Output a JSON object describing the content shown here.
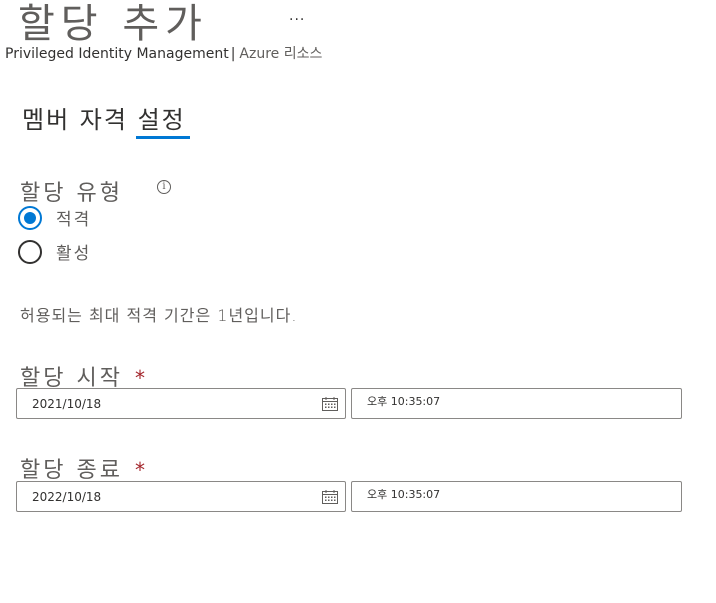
{
  "header": {
    "title": "할당 추가",
    "more": "...",
    "breadcrumb_product": "Privileged Identity Management",
    "breadcrumb_sep": "|",
    "breadcrumb_resource": "Azure 리소스"
  },
  "tabs": {
    "settings_prefix": "멤버 자격 ",
    "settings_active": "설정"
  },
  "assignment_type": {
    "label": "할당 유형",
    "info_icon": "i",
    "options": [
      {
        "label": "적격",
        "checked": true
      },
      {
        "label": "활성",
        "checked": false
      }
    ]
  },
  "note": "허용되는 최대 적격 기간은 1년입니다.",
  "start": {
    "label": "할당 시작",
    "required": "*",
    "date": "2021/10/18",
    "time": "오후 10:35:07"
  },
  "end": {
    "label": "할당 종료",
    "required": "*",
    "date": "2022/10/18",
    "time": "오후 10:35:07"
  },
  "colors": {
    "accent": "#0078d4",
    "required": "#a4262c",
    "border": "#8a8886"
  }
}
